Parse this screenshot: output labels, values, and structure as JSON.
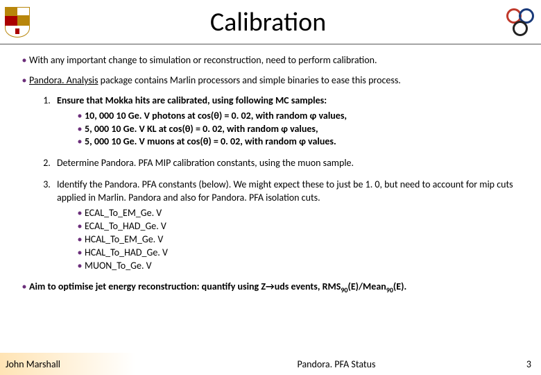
{
  "title": "Calibration",
  "bullets": {
    "b1": "With any important change to simulation or reconstruction, need to perform calibration.",
    "b2_pre": "Pandora. Analysis",
    "b2_post": " package contains Marlin processors and simple binaries to ease this process.",
    "b3_pre": "Aim to optimise jet energy reconstruction: quantify using Z→uds events, RMS",
    "b3_mid": "(E)/Mean",
    "b3_end": "(E).",
    "sub90": "90"
  },
  "steps": {
    "s1_head": "Ensure that Mokka hits are calibrated, using following MC samples:",
    "s1_items": [
      "10, 000 10 Ge. V photons at cos(θ) = 0. 02, with random φ values,",
      "5, 000 10 Ge. V KL at cos(θ) = 0. 02, with random φ values,",
      "5, 000 10 Ge. V muons at cos(θ) = 0. 02, with random φ values."
    ],
    "s2": "Determine Pandora. PFA MIP calibration constants, using the muon sample.",
    "s3_head": "Identify the Pandora. PFA constants (below). We might expect these to just be 1. 0, but need to account for mip cuts applied in Marlin. Pandora and also for Pandora. PFA isolation cuts.",
    "s3_items": [
      "ECAL_To_EM_Ge. V",
      "ECAL_To_HAD_Ge. V",
      "HCAL_To_EM_Ge. V",
      "HCAL_To_HAD_Ge. V",
      "MUON_To_Ge. V"
    ]
  },
  "footer": {
    "left": "John Marshall",
    "center": "Pandora. PFA Status",
    "right": "3"
  },
  "glyphs": {
    "bullet": "•"
  }
}
